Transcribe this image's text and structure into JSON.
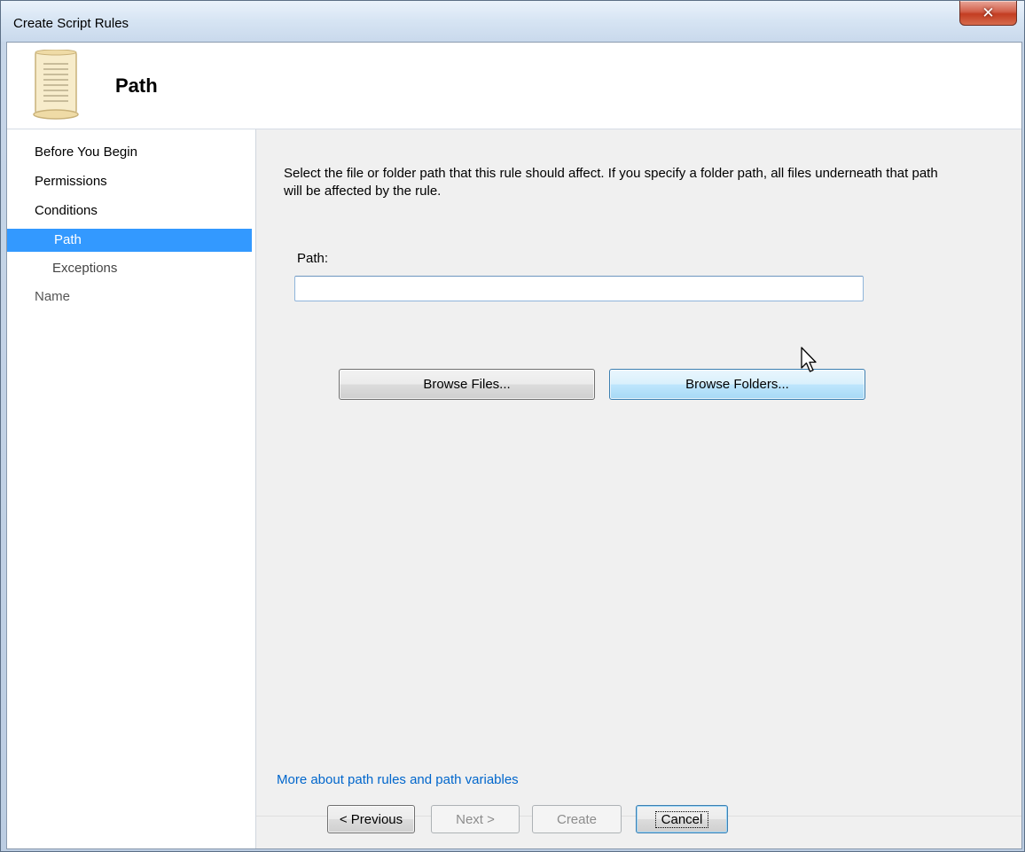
{
  "window": {
    "title": "Create Script Rules",
    "close_glyph": "✕"
  },
  "header": {
    "title": "Path",
    "icon": "scroll-document-icon"
  },
  "sidebar": {
    "items": [
      {
        "label": "Before You Begin",
        "level": "top",
        "selected": false
      },
      {
        "label": "Permissions",
        "level": "top",
        "selected": false
      },
      {
        "label": "Conditions",
        "level": "top",
        "selected": false
      },
      {
        "label": "Path",
        "level": "sub",
        "selected": true
      },
      {
        "label": "Exceptions",
        "level": "sub",
        "selected": false
      },
      {
        "label": "Name",
        "level": "top",
        "selected": false
      }
    ]
  },
  "main": {
    "description": "Select the file or folder path that this rule should affect. If you specify a folder path, all files underneath that path will be affected by the rule.",
    "path_label": "Path:",
    "path_value": "",
    "browse_files_label": "Browse Files...",
    "browse_folders_label": "Browse Folders...",
    "more_link": "More about path rules and path variables"
  },
  "footer": {
    "previous_label": "< Previous",
    "next_label": "Next >",
    "create_label": "Create",
    "cancel_label": "Cancel"
  },
  "colors": {
    "selection": "#3399ff",
    "link": "#0066cc",
    "close": "#c33d22"
  }
}
